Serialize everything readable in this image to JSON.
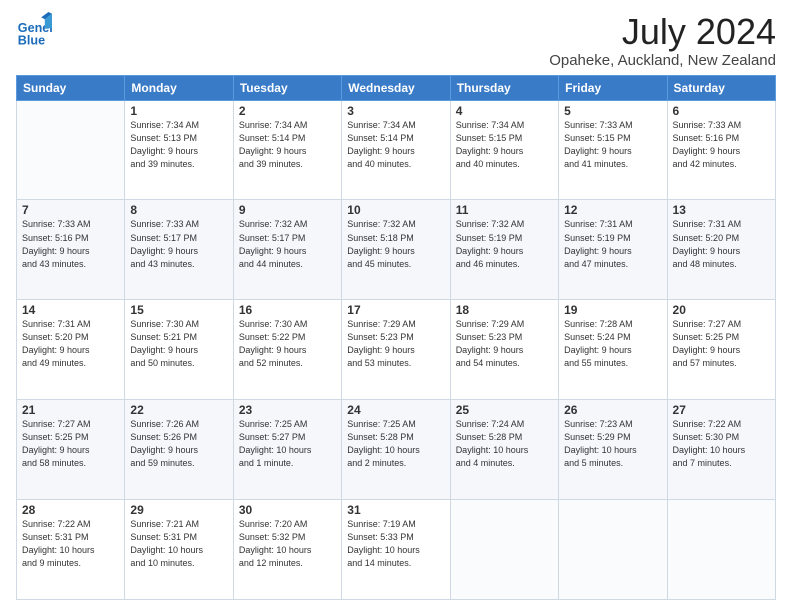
{
  "header": {
    "logo_line1": "General",
    "logo_line2": "Blue",
    "title": "July 2024",
    "location": "Opaheke, Auckland, New Zealand"
  },
  "weekdays": [
    "Sunday",
    "Monday",
    "Tuesday",
    "Wednesday",
    "Thursday",
    "Friday",
    "Saturday"
  ],
  "weeks": [
    [
      {
        "day": "",
        "info": ""
      },
      {
        "day": "1",
        "info": "Sunrise: 7:34 AM\nSunset: 5:13 PM\nDaylight: 9 hours\nand 39 minutes."
      },
      {
        "day": "2",
        "info": "Sunrise: 7:34 AM\nSunset: 5:14 PM\nDaylight: 9 hours\nand 39 minutes."
      },
      {
        "day": "3",
        "info": "Sunrise: 7:34 AM\nSunset: 5:14 PM\nDaylight: 9 hours\nand 40 minutes."
      },
      {
        "day": "4",
        "info": "Sunrise: 7:34 AM\nSunset: 5:15 PM\nDaylight: 9 hours\nand 40 minutes."
      },
      {
        "day": "5",
        "info": "Sunrise: 7:33 AM\nSunset: 5:15 PM\nDaylight: 9 hours\nand 41 minutes."
      },
      {
        "day": "6",
        "info": "Sunrise: 7:33 AM\nSunset: 5:16 PM\nDaylight: 9 hours\nand 42 minutes."
      }
    ],
    [
      {
        "day": "7",
        "info": "Sunrise: 7:33 AM\nSunset: 5:16 PM\nDaylight: 9 hours\nand 43 minutes."
      },
      {
        "day": "8",
        "info": "Sunrise: 7:33 AM\nSunset: 5:17 PM\nDaylight: 9 hours\nand 43 minutes."
      },
      {
        "day": "9",
        "info": "Sunrise: 7:32 AM\nSunset: 5:17 PM\nDaylight: 9 hours\nand 44 minutes."
      },
      {
        "day": "10",
        "info": "Sunrise: 7:32 AM\nSunset: 5:18 PM\nDaylight: 9 hours\nand 45 minutes."
      },
      {
        "day": "11",
        "info": "Sunrise: 7:32 AM\nSunset: 5:19 PM\nDaylight: 9 hours\nand 46 minutes."
      },
      {
        "day": "12",
        "info": "Sunrise: 7:31 AM\nSunset: 5:19 PM\nDaylight: 9 hours\nand 47 minutes."
      },
      {
        "day": "13",
        "info": "Sunrise: 7:31 AM\nSunset: 5:20 PM\nDaylight: 9 hours\nand 48 minutes."
      }
    ],
    [
      {
        "day": "14",
        "info": "Sunrise: 7:31 AM\nSunset: 5:20 PM\nDaylight: 9 hours\nand 49 minutes."
      },
      {
        "day": "15",
        "info": "Sunrise: 7:30 AM\nSunset: 5:21 PM\nDaylight: 9 hours\nand 50 minutes."
      },
      {
        "day": "16",
        "info": "Sunrise: 7:30 AM\nSunset: 5:22 PM\nDaylight: 9 hours\nand 52 minutes."
      },
      {
        "day": "17",
        "info": "Sunrise: 7:29 AM\nSunset: 5:23 PM\nDaylight: 9 hours\nand 53 minutes."
      },
      {
        "day": "18",
        "info": "Sunrise: 7:29 AM\nSunset: 5:23 PM\nDaylight: 9 hours\nand 54 minutes."
      },
      {
        "day": "19",
        "info": "Sunrise: 7:28 AM\nSunset: 5:24 PM\nDaylight: 9 hours\nand 55 minutes."
      },
      {
        "day": "20",
        "info": "Sunrise: 7:27 AM\nSunset: 5:25 PM\nDaylight: 9 hours\nand 57 minutes."
      }
    ],
    [
      {
        "day": "21",
        "info": "Sunrise: 7:27 AM\nSunset: 5:25 PM\nDaylight: 9 hours\nand 58 minutes."
      },
      {
        "day": "22",
        "info": "Sunrise: 7:26 AM\nSunset: 5:26 PM\nDaylight: 9 hours\nand 59 minutes."
      },
      {
        "day": "23",
        "info": "Sunrise: 7:25 AM\nSunset: 5:27 PM\nDaylight: 10 hours\nand 1 minute."
      },
      {
        "day": "24",
        "info": "Sunrise: 7:25 AM\nSunset: 5:28 PM\nDaylight: 10 hours\nand 2 minutes."
      },
      {
        "day": "25",
        "info": "Sunrise: 7:24 AM\nSunset: 5:28 PM\nDaylight: 10 hours\nand 4 minutes."
      },
      {
        "day": "26",
        "info": "Sunrise: 7:23 AM\nSunset: 5:29 PM\nDaylight: 10 hours\nand 5 minutes."
      },
      {
        "day": "27",
        "info": "Sunrise: 7:22 AM\nSunset: 5:30 PM\nDaylight: 10 hours\nand 7 minutes."
      }
    ],
    [
      {
        "day": "28",
        "info": "Sunrise: 7:22 AM\nSunset: 5:31 PM\nDaylight: 10 hours\nand 9 minutes."
      },
      {
        "day": "29",
        "info": "Sunrise: 7:21 AM\nSunset: 5:31 PM\nDaylight: 10 hours\nand 10 minutes."
      },
      {
        "day": "30",
        "info": "Sunrise: 7:20 AM\nSunset: 5:32 PM\nDaylight: 10 hours\nand 12 minutes."
      },
      {
        "day": "31",
        "info": "Sunrise: 7:19 AM\nSunset: 5:33 PM\nDaylight: 10 hours\nand 14 minutes."
      },
      {
        "day": "",
        "info": ""
      },
      {
        "day": "",
        "info": ""
      },
      {
        "day": "",
        "info": ""
      }
    ]
  ]
}
